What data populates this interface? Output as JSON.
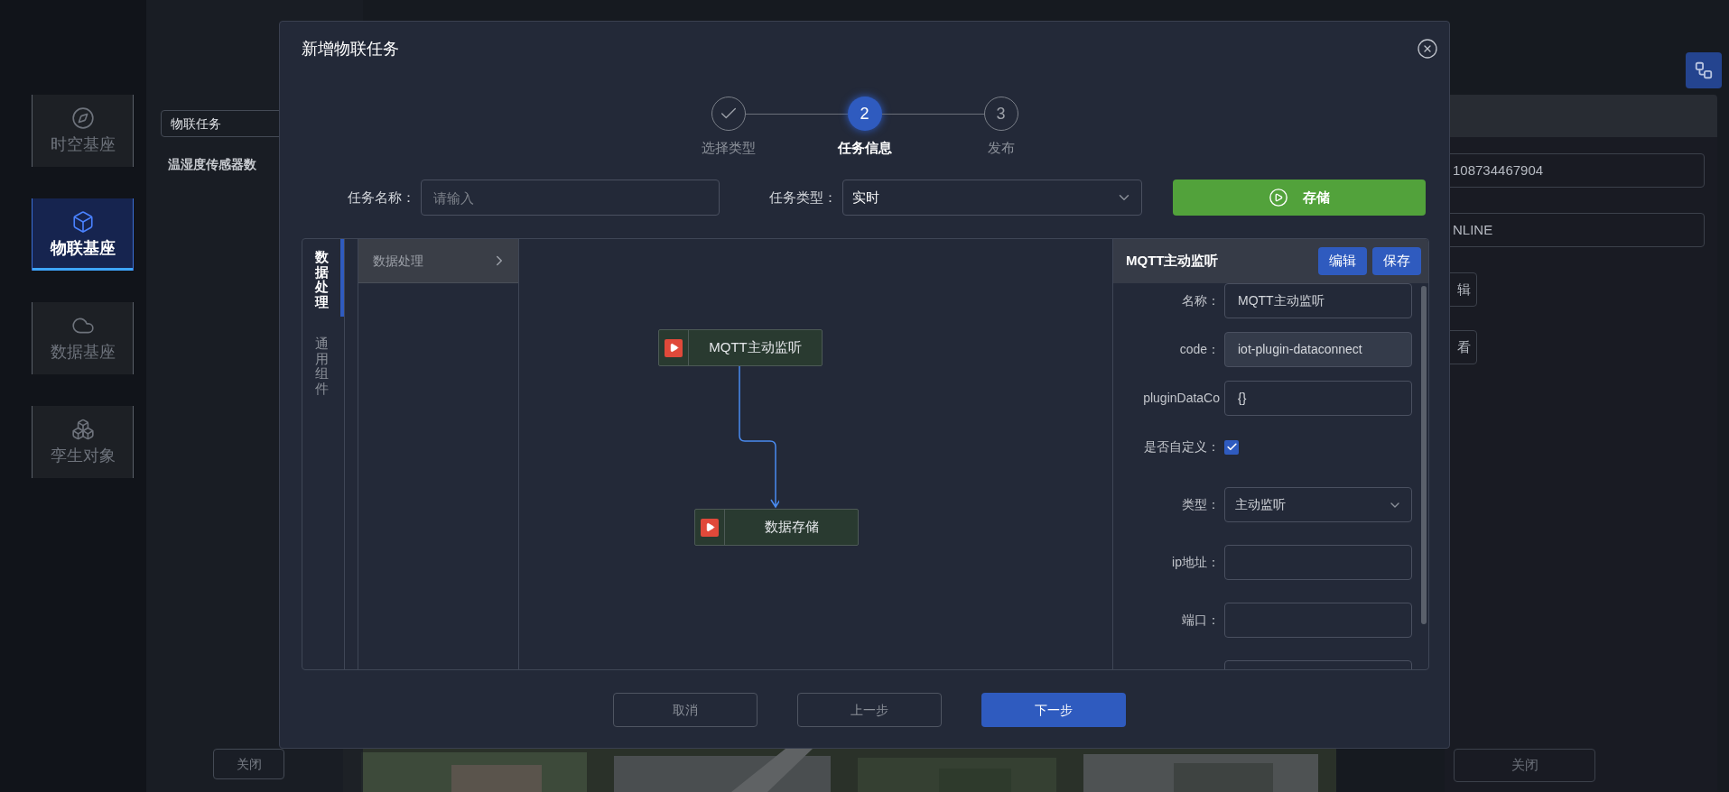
{
  "sidebar": {
    "items": [
      {
        "label": "时空基座",
        "selected": false
      },
      {
        "label": "物联基座",
        "selected": true
      },
      {
        "label": "数据基座",
        "selected": false
      },
      {
        "label": "孪生对象",
        "selected": false
      }
    ]
  },
  "left_panel": {
    "select": {
      "value": "物联任务"
    },
    "item": "温湿度传感器数",
    "close_button": "关闭"
  },
  "right_panel": {
    "fields": [
      "108734467904",
      "NLINE"
    ],
    "buttons": [
      "辑",
      "看"
    ],
    "close_button": "关闭"
  },
  "modal": {
    "title": "新增物联任务",
    "steps": [
      {
        "label": "选择类型",
        "completed": true,
        "selected": false
      },
      {
        "label": "任务信息",
        "number": "2",
        "completed": false,
        "selected": true
      },
      {
        "label": "发布",
        "number": "3",
        "completed": false,
        "selected": false
      }
    ],
    "form": {
      "name": {
        "label": "任务名称：",
        "placeholder": "请输入"
      },
      "type": {
        "label": "任务类型：",
        "value": "实时"
      },
      "save_button": "存储"
    },
    "tabs": [
      {
        "label": "数据处理",
        "selected": true
      },
      {
        "label": "通用组件",
        "selected": false
      }
    ],
    "categories": [
      {
        "label": "数据处理",
        "expanded": false
      }
    ],
    "nodes": [
      {
        "label": "MQTT主动监听"
      },
      {
        "label": "数据存储"
      }
    ],
    "properties": {
      "title": "MQTT主动监听",
      "buttons": [
        "编辑",
        "保存"
      ],
      "fields": [
        {
          "kind": "input",
          "label": "名称：",
          "value": "MQTT主动监听",
          "disabled": false
        },
        {
          "kind": "input",
          "label": "code：",
          "value": "iot-plugin-dataconnect",
          "disabled": true
        },
        {
          "kind": "input",
          "label": "pluginDataCo",
          "value": "{}",
          "disabled": false
        },
        {
          "kind": "checkbox",
          "label": "是否自定义：",
          "checked": true
        },
        {
          "kind": "select",
          "label": "类型：",
          "value": "主动监听"
        },
        {
          "kind": "input",
          "label": "ip地址：",
          "disabled": false
        },
        {
          "kind": "input",
          "label": "端口：",
          "disabled": false
        },
        {
          "kind": "input",
          "disabled": false
        }
      ]
    },
    "footer": [
      {
        "label": "取消",
        "kind": "plain"
      },
      {
        "label": "上一步",
        "kind": "plain"
      },
      {
        "label": "下一步",
        "kind": "primary"
      }
    ]
  }
}
